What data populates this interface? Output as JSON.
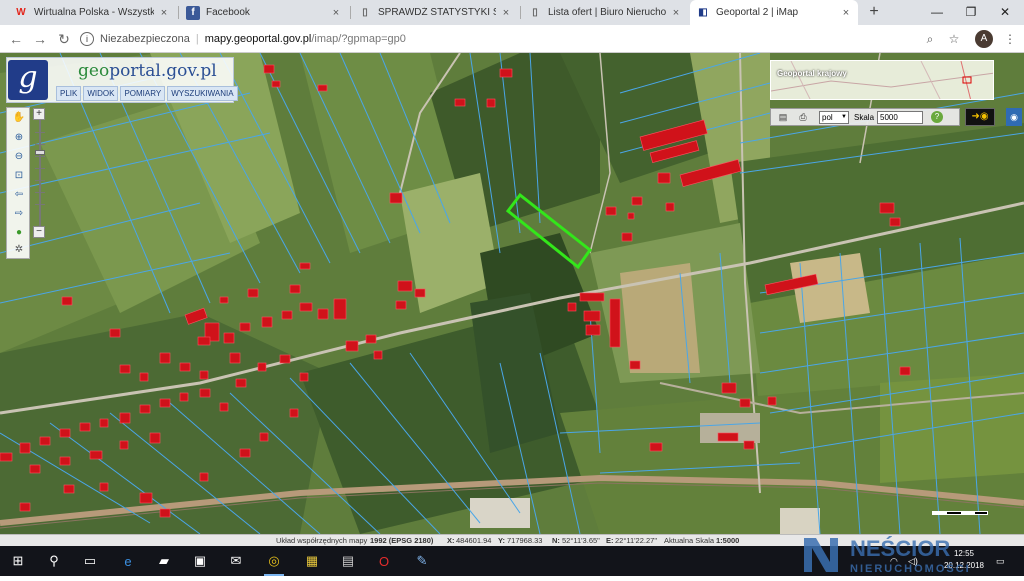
{
  "browser": {
    "tabs": [
      {
        "title": "Wirtualna Polska - Wszystko co",
        "favicon": "wp-icon",
        "fav_color": "#e2251b",
        "active": false
      },
      {
        "title": "Facebook",
        "favicon": "facebook-icon",
        "fav_color": "#3b5998",
        "active": false
      },
      {
        "title": "SPRAWDŹ STATYSTYKI SERWIS",
        "favicon": "page-icon",
        "fav_color": "#777777",
        "active": false
      },
      {
        "title": "Lista ofert | Biuro Nieruchomo",
        "favicon": "page-icon",
        "fav_color": "#777777",
        "active": false
      },
      {
        "title": "Geoportal 2 | iMap",
        "favicon": "geoportal-icon",
        "fav_color": "#213c89",
        "active": true
      }
    ],
    "tab_close_glyph": "×",
    "new_tab_glyph": "+",
    "address": {
      "security_label": "Niezabezpieczona",
      "host": "mapy.geoportal.gov.pl",
      "path": "/imap/?gpmap=gp0"
    },
    "avatar_letter": "A"
  },
  "app": {
    "logo_letter": "g",
    "logo_text_prefix": "geo",
    "logo_text_rest": "portal.gov.pl",
    "menu": [
      "PLIK",
      "WIDOK",
      "POMIARY",
      "WYSZUKIWANIA"
    ],
    "overview_title": "Geoportal krajowy",
    "language": "pol",
    "scale_label": "Skala",
    "scale_value": "5000",
    "help_glyph": "?"
  },
  "status_bar": {
    "crs_label": "Układ współrzędnych mapy",
    "crs_value": "1992 (EPSG 2180)",
    "x_label": "X:",
    "x_value": "484601.94",
    "y_label": "Y:",
    "y_value": "717968.33",
    "n_label": "N:",
    "n_value": "52°11'3.65\"",
    "e_label": "E:",
    "e_value": "22°11'22.27\"",
    "scale_label": "Aktualna Skala",
    "scale_value": "1:5000"
  },
  "taskbar": {
    "time": "12:55",
    "date": "20.12.2018",
    "watermark_top": "NEŚCIOR",
    "watermark_bottom": "NIERUCHOMOŚCI"
  },
  "colors": {
    "parcel_lines": "#4aa6e8",
    "buildings": "#d0121a",
    "selected_parcel": "#33e61a"
  }
}
